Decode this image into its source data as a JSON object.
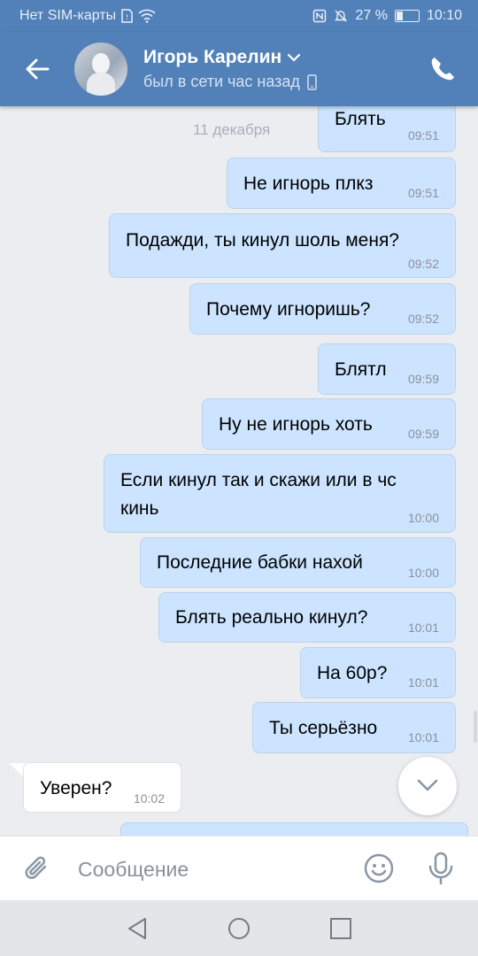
{
  "status_bar": {
    "carrier": "Нет SIM-карты",
    "battery": "27 %",
    "battery_level": 0.27,
    "time": "10:10"
  },
  "header": {
    "name": "Игорь Карелин",
    "status": "был в сети час назад"
  },
  "chat": {
    "date": "11 декабря"
  },
  "messages": [
    {
      "text": "Блять",
      "time": "09:51",
      "dir": "out"
    },
    {
      "text": "Не игнорь плкз",
      "time": "09:51",
      "dir": "out"
    },
    {
      "text": "Подажди, ты кинул шоль меня?",
      "time": "09:52",
      "dir": "out"
    },
    {
      "text": "Почему игноришь?",
      "time": "09:52",
      "dir": "out"
    },
    {
      "text": "Блятл",
      "time": "09:59",
      "dir": "out"
    },
    {
      "text": "Ну не игнорь хоть",
      "time": "09:59",
      "dir": "out"
    },
    {
      "text": "Если кинул так и скажи или в чс",
      "text2": "кинь",
      "time": "10:00",
      "dir": "out"
    },
    {
      "text": "Последние бабки нахой",
      "time": "10:00",
      "dir": "out"
    },
    {
      "text": "Блять реально кинул?",
      "time": "10:01",
      "dir": "out"
    },
    {
      "text": "На 60р?",
      "time": "10:01",
      "dir": "out"
    },
    {
      "text": "Ты серьёзно",
      "time": "10:01",
      "dir": "out"
    },
    {
      "text": "Уверен?",
      "time": "10:02",
      "dir": "in"
    }
  ],
  "composer": {
    "placeholder": "Сообщение"
  },
  "colors": {
    "header": "#5181b8",
    "outgoing_bubble": "#cce4ff",
    "incoming_bubble": "#ffffff",
    "background": "#ebedf0"
  },
  "icons": [
    "back-arrow-icon",
    "phone-icon",
    "chevron-down-icon",
    "mobile-icon",
    "attach-icon",
    "emoji-icon",
    "microphone-icon",
    "scroll-down-icon",
    "nav-back-icon",
    "nav-home-icon",
    "nav-recent-icon"
  ]
}
